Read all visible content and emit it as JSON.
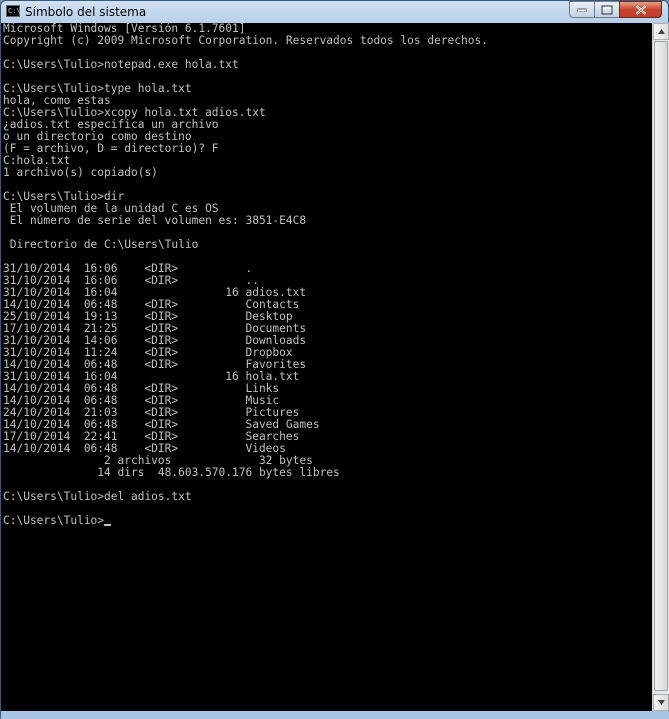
{
  "window": {
    "title": "Símbolo del sistema",
    "icon_label": "C:\\",
    "controls": [
      "minimize-icon",
      "maximize-icon",
      "close-icon"
    ]
  },
  "console": {
    "text": "Microsoft Windows [Versión 6.1.7601]\nCopyright (c) 2009 Microsoft Corporation. Reservados todos los derechos.\n\nC:\\Users\\Tulio>notepad.exe hola.txt\n\nC:\\Users\\Tulio>type hola.txt\nhola, como estas\nC:\\Users\\Tulio>xcopy hola.txt adios.txt\n¿adios.txt especifica un archivo\no un directorio como destino\n(F = archivo, D = directorio)? F\nC:hola.txt\n1 archivo(s) copiado(s)\n\nC:\\Users\\Tulio>dir\n El volumen de la unidad C es OS\n El número de serie del volumen es: 3851-E4C8\n\n Directorio de C:\\Users\\Tulio\n\n31/10/2014  16:06    <DIR>          .\n31/10/2014  16:06    <DIR>          ..\n31/10/2014  16:04                16 adios.txt\n14/10/2014  06:48    <DIR>          Contacts\n25/10/2014  19:13    <DIR>          Desktop\n17/10/2014  21:25    <DIR>          Documents\n31/10/2014  14:06    <DIR>          Downloads\n31/10/2014  11:24    <DIR>          Dropbox\n14/10/2014  06:48    <DIR>          Favorites\n31/10/2014  16:04                16 hola.txt\n14/10/2014  06:48    <DIR>          Links\n14/10/2014  06:48    <DIR>          Music\n24/10/2014  21:03    <DIR>          Pictures\n14/10/2014  06:48    <DIR>          Saved Games\n17/10/2014  22:41    <DIR>          Searches\n14/10/2014  06:48    <DIR>          Videos\n               2 archivos             32 bytes\n              14 dirs  48.603.570.176 bytes libres\n\nC:\\Users\\Tulio>del adios.txt\n\nC:\\Users\\Tulio>"
  },
  "colors": {
    "console_bg": "#000000",
    "console_fg": "#c0c0c0",
    "close_button": "#c0392b"
  }
}
